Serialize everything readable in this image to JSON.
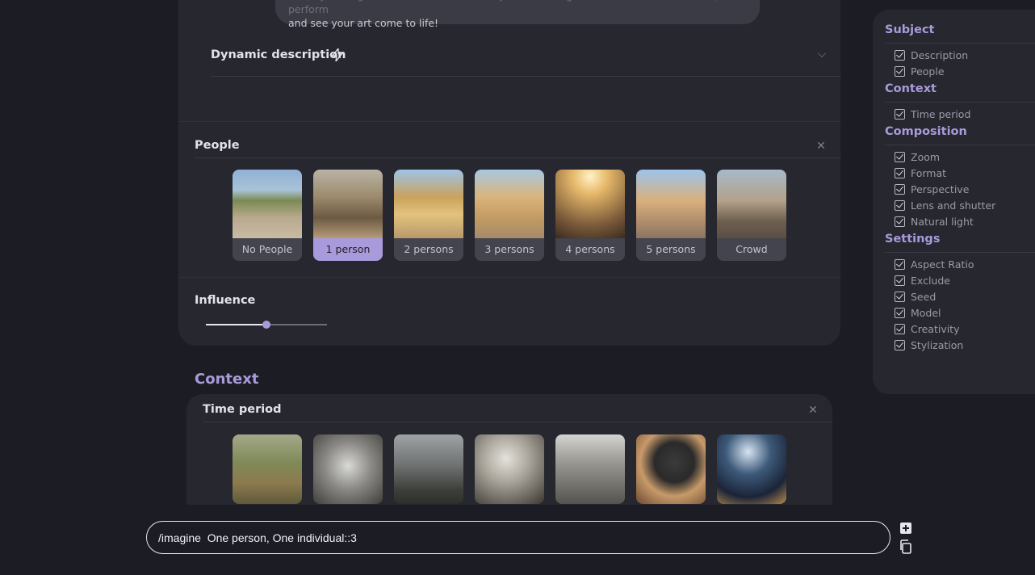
{
  "description_box": {
    "line1": "ime, by adding an artistic accent in the style of Van Gogh\" or \"with a film-like effect\", to perform",
    "line2": "and see your art come to life!"
  },
  "dynamic_description": {
    "title": "Dynamic description",
    "icon": "lightning-icon"
  },
  "people": {
    "title": "People",
    "options": [
      {
        "label": "No People",
        "selected": false
      },
      {
        "label": "1 person",
        "selected": true
      },
      {
        "label": "2 persons",
        "selected": false
      },
      {
        "label": "3 persons",
        "selected": false
      },
      {
        "label": "4 persons",
        "selected": false
      },
      {
        "label": "5 persons",
        "selected": false
      },
      {
        "label": "Crowd",
        "selected": false
      }
    ]
  },
  "influence": {
    "title": "Influence",
    "value": 0.5
  },
  "context": {
    "heading": "Context",
    "time_period": {
      "title": "Time period",
      "options_count_visible": 7
    }
  },
  "prompt": {
    "value": "/imagine  One person, One individual::3"
  },
  "sidebar": {
    "sections": [
      {
        "title": "Subject",
        "items": [
          "Description",
          "People"
        ]
      },
      {
        "title": "Context",
        "items": [
          "Time period"
        ]
      },
      {
        "title": "Composition",
        "items": [
          "Zoom",
          "Format",
          "Perspective",
          "Lens and shutter",
          "Natural light"
        ]
      },
      {
        "title": "Settings",
        "items": [
          "Aspect Ratio",
          "Exclude",
          "Seed",
          "Model",
          "Creativity",
          "Stylization"
        ]
      }
    ]
  },
  "colors": {
    "accent": "#a99bdb",
    "background": "#1c1d24",
    "panel": "#26272f"
  }
}
